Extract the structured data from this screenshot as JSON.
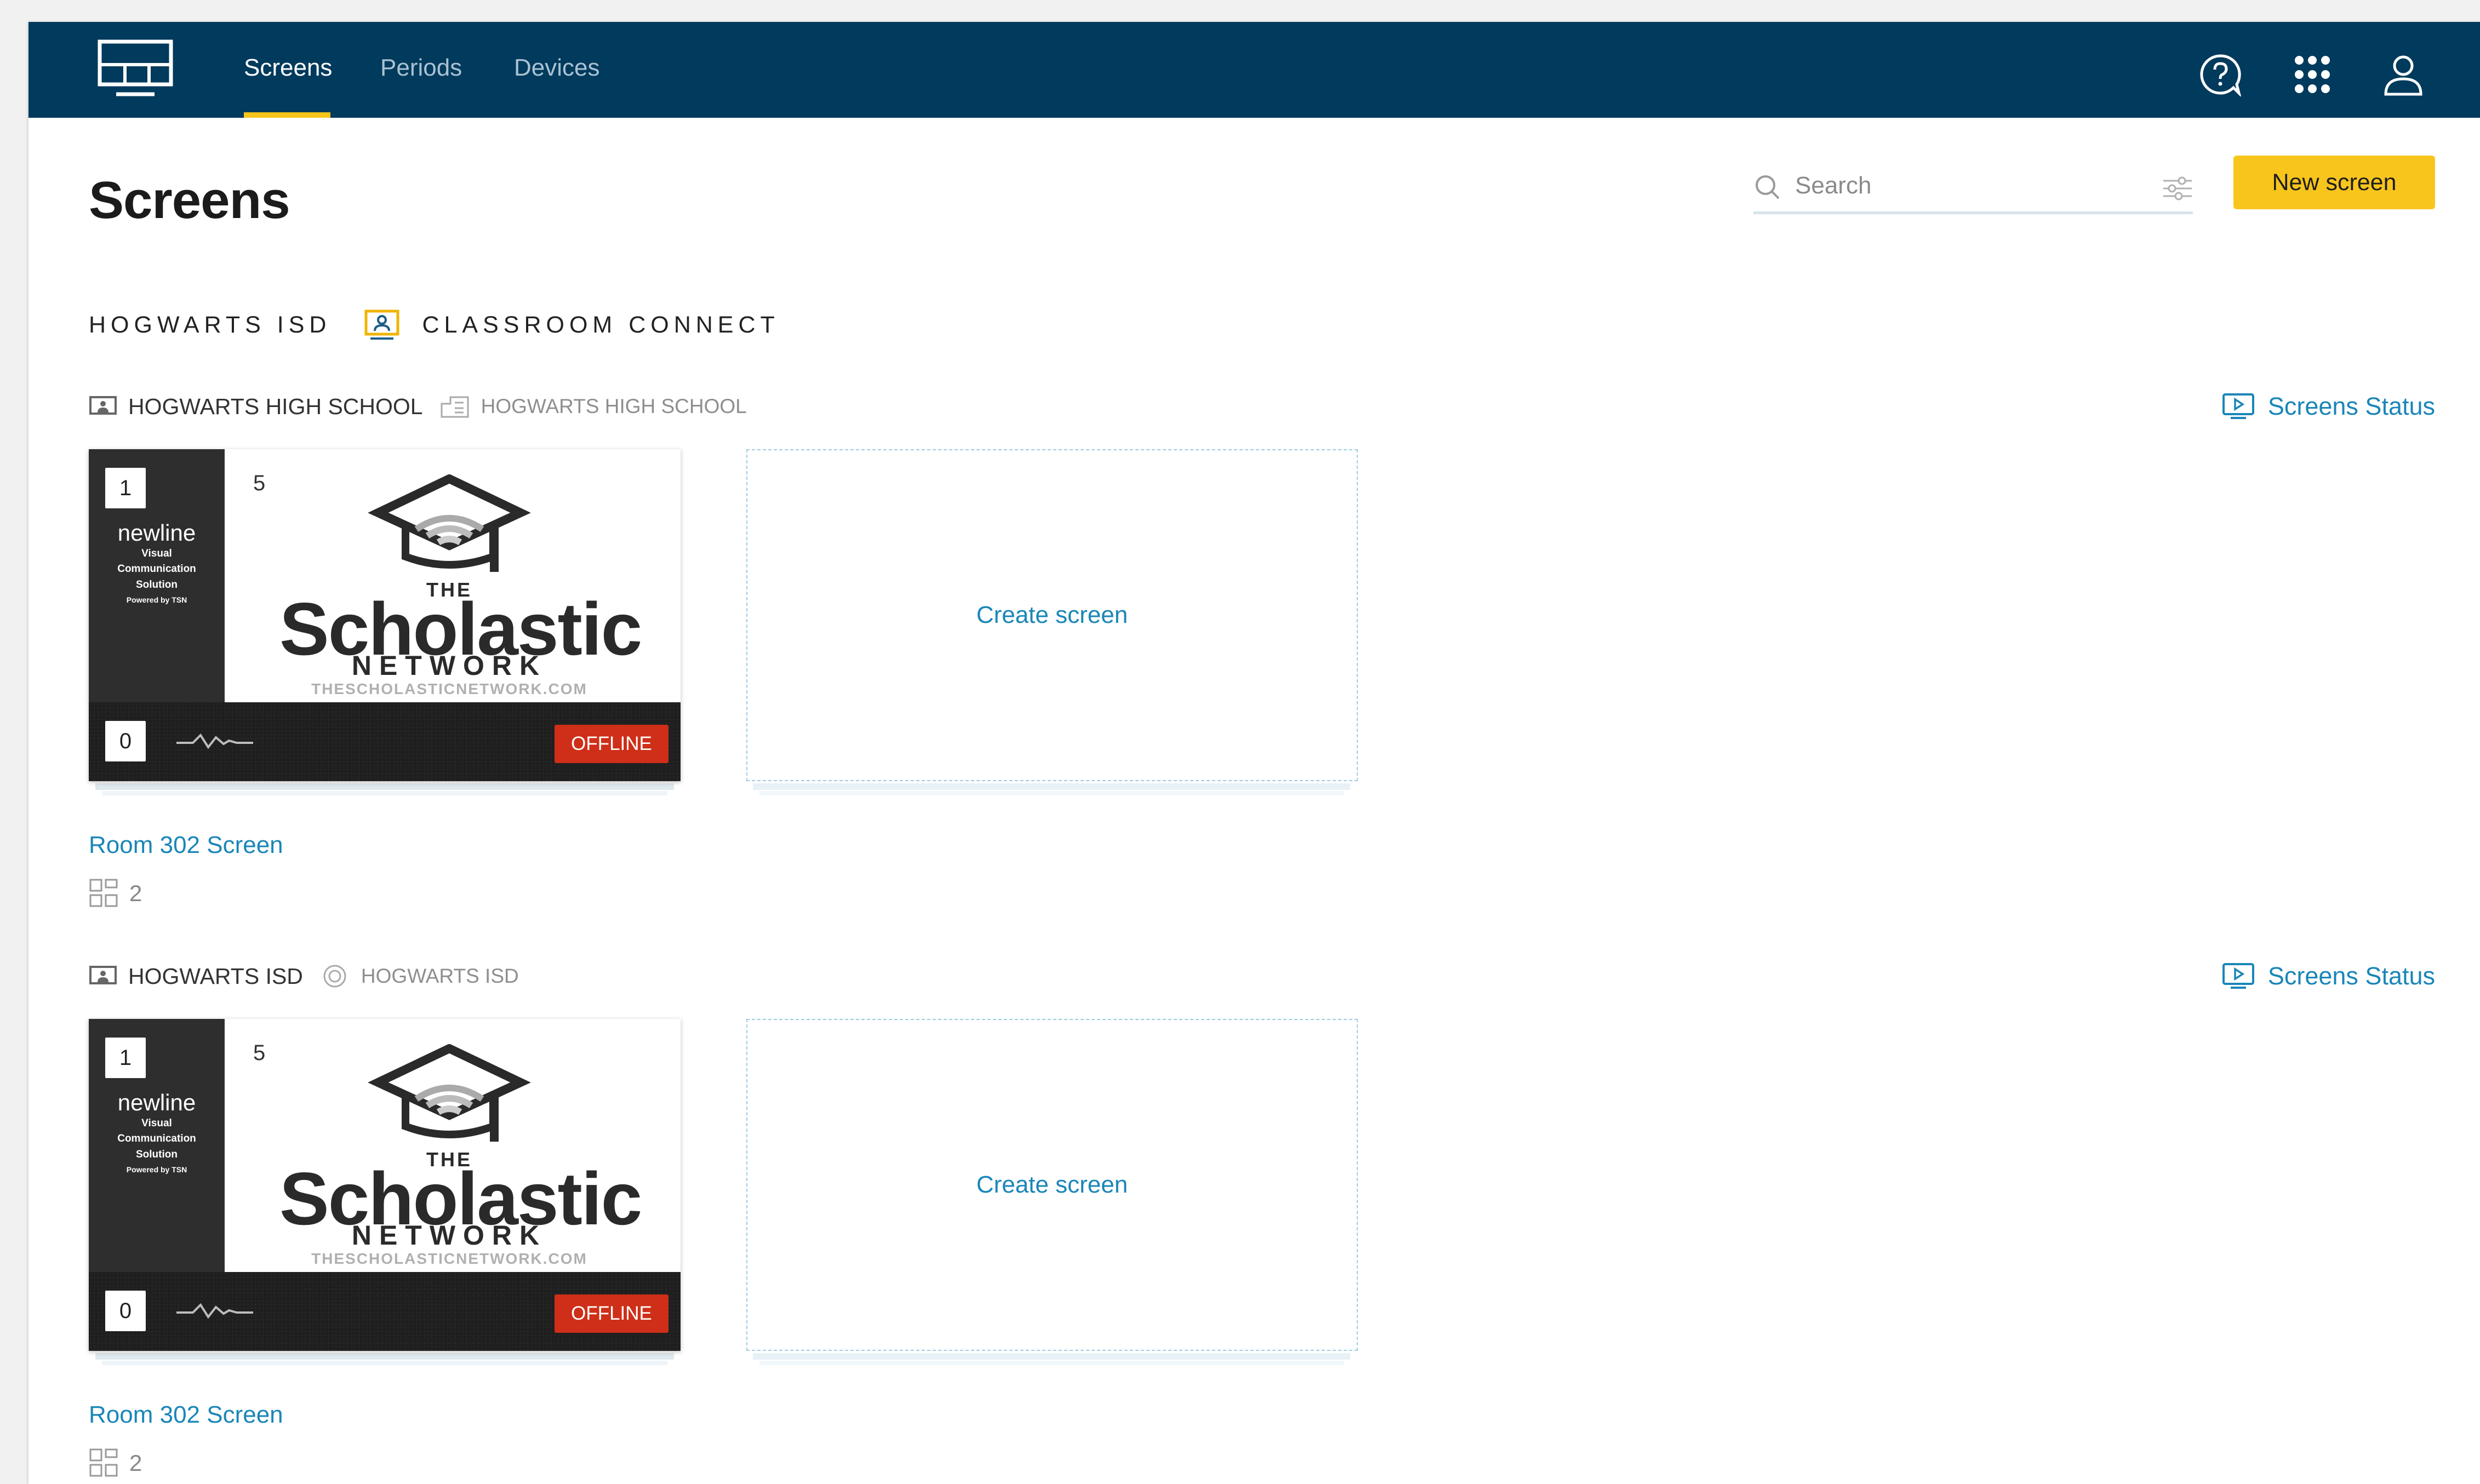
{
  "nav": {
    "tabs": [
      {
        "label": "Screens",
        "active": true
      },
      {
        "label": "Periods",
        "active": false
      },
      {
        "label": "Devices",
        "active": false
      }
    ],
    "icons": [
      "help-icon",
      "apps-grid-icon",
      "user-icon"
    ]
  },
  "header": {
    "title": "Screens",
    "search_placeholder": "Search",
    "new_button": "New screen"
  },
  "org": {
    "district": "HOGWARTS ISD",
    "product": "CLASSROOM CONNECT"
  },
  "sections": [
    {
      "location": "HOGWARTS HIGH SCHOOL",
      "sub_location": "HOGWARTS HIGH SCHOOL",
      "status_link": "Screens Status",
      "card": {
        "top_badge": "1",
        "count": "5",
        "bottom_badge": "0",
        "status": "OFFLINE",
        "brand": {
          "name": "newline",
          "line1": "Visual",
          "line2": "Communication",
          "line3": "Solution",
          "powered": "Powered by TSN"
        },
        "thumbnail": {
          "the": "THE",
          "name": "Scholastic",
          "network": "NETWORK",
          "url": "THESCHOLASTICNETWORK.COM"
        }
      },
      "create_label": "Create screen",
      "screen_name": "Room 302 Screen",
      "layouts_count": "2"
    },
    {
      "location": "HOGWARTS ISD",
      "sub_location": "HOGWARTS ISD",
      "status_link": "Screens Status",
      "card": {
        "top_badge": "1",
        "count": "5",
        "bottom_badge": "0",
        "status": "OFFLINE",
        "brand": {
          "name": "newline",
          "line1": "Visual",
          "line2": "Communication",
          "line3": "Solution",
          "powered": "Powered by TSN"
        },
        "thumbnail": {
          "the": "THE",
          "name": "Scholastic",
          "network": "NETWORK",
          "url": "THESCHOLASTICNETWORK.COM"
        }
      },
      "create_label": "Create screen",
      "screen_name": "Room 302 Screen",
      "layouts_count": "2"
    }
  ],
  "colors": {
    "topbar": "#003a5c",
    "accent_yellow": "#f8c51c",
    "link_blue": "#1a86b8",
    "offline_red": "#cf2f18"
  }
}
